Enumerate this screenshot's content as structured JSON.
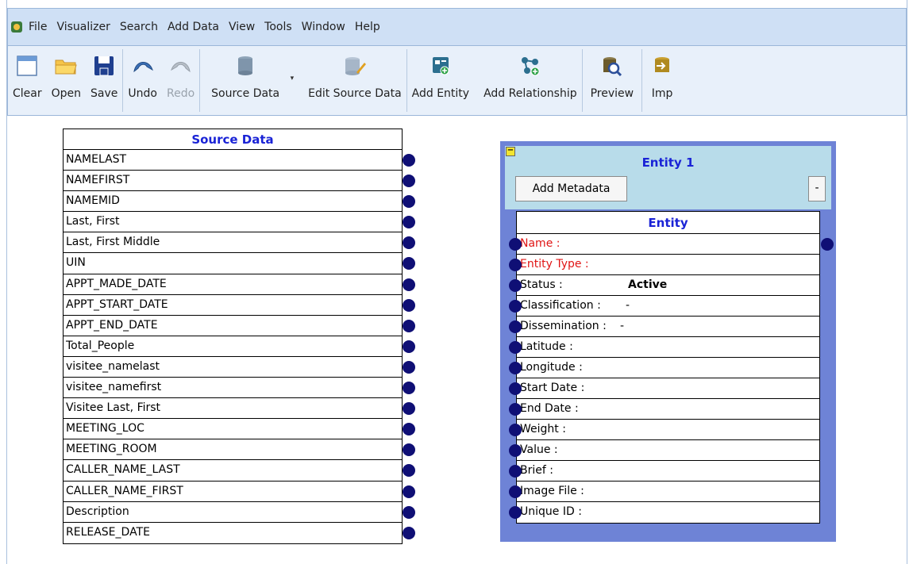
{
  "menubar": {
    "items": [
      "File",
      "Visualizer",
      "Search",
      "Add Data",
      "View",
      "Tools",
      "Window",
      "Help"
    ]
  },
  "toolbar": {
    "buttons": [
      {
        "label": "Clear",
        "icon": "clear-icon",
        "enabled": true
      },
      {
        "label": "Open",
        "icon": "folder-icon",
        "enabled": true
      },
      {
        "label": "Save",
        "icon": "save-icon",
        "enabled": true
      },
      {
        "label": "Undo",
        "icon": "undo-icon",
        "enabled": true
      },
      {
        "label": "Redo",
        "icon": "redo-icon",
        "enabled": false
      },
      {
        "label": "Source Data",
        "icon": "database-icon",
        "enabled": true
      },
      {
        "label": "Edit Source Data",
        "icon": "edit-database-icon",
        "enabled": true
      },
      {
        "label": "Add Entity",
        "icon": "add-entity-icon",
        "enabled": true
      },
      {
        "label": "Add Relationship",
        "icon": "add-relationship-icon",
        "enabled": true
      },
      {
        "label": "Preview",
        "icon": "preview-icon",
        "enabled": true
      },
      {
        "label": "Imp",
        "icon": "import-icon",
        "enabled": true
      }
    ]
  },
  "source_data": {
    "title": "Source Data",
    "fields": [
      "NAMELAST",
      "NAMEFIRST",
      "NAMEMID",
      "Last, First",
      "Last, First Middle",
      "UIN",
      "APPT_MADE_DATE",
      "APPT_START_DATE",
      "APPT_END_DATE",
      "Total_People",
      "visitee_namelast",
      "visitee_namefirst",
      "Visitee Last, First",
      "MEETING_LOC",
      "MEETING_ROOM",
      "CALLER_NAME_LAST",
      "CALLER_NAME_FIRST",
      "Description",
      "RELEASE_DATE"
    ]
  },
  "entity": {
    "title": "Entity 1",
    "add_metadata_label": "Add Metadata",
    "minus_label": "-",
    "collapse_label": "−",
    "table_title": "Entity",
    "fields": {
      "name": "Name :",
      "entity_type": "Entity Type :",
      "status": "Status :",
      "status_value": "Active",
      "classification": "Classification :",
      "classification_value": "-",
      "dissemination": "Dissemination :",
      "dissemination_value": "-",
      "latitude": "Latitude :",
      "longitude": "Longitude :",
      "start_date": "Start Date :",
      "end_date": "End Date :",
      "weight": "Weight :",
      "value": "Value :",
      "brief": "Brief :",
      "image_file": "Image File :",
      "unique_id": "Unique ID :"
    }
  },
  "colors": {
    "accent_blue": "#1a23d6",
    "required_red": "#e01515",
    "entity_panel": "#6e83d6",
    "entity_header": "#b8dcea",
    "port": "#0f0f75"
  }
}
